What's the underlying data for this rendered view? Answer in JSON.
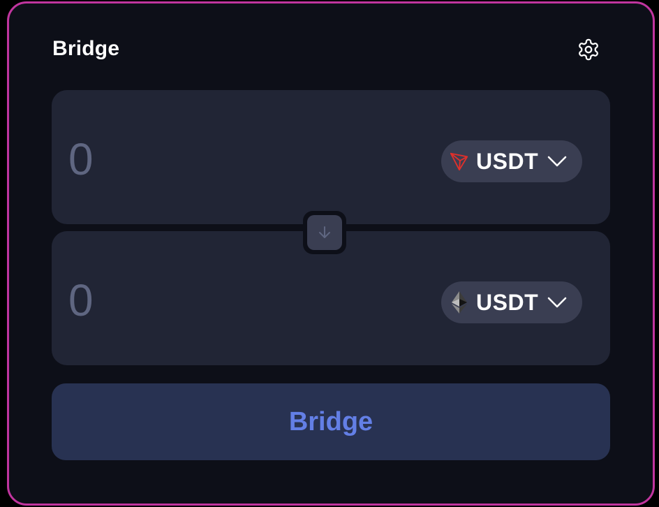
{
  "header": {
    "title": "Bridge",
    "settings_icon": "gear-icon"
  },
  "from": {
    "amount_placeholder": "0",
    "token_symbol": "USDT",
    "chain_icon": "tron-icon"
  },
  "to": {
    "amount_placeholder": "0",
    "token_symbol": "USDT",
    "chain_icon": "ethereum-icon"
  },
  "swap": {
    "icon": "arrow-down-icon"
  },
  "action": {
    "bridge_label": "Bridge"
  },
  "colors": {
    "card_border": "#c1359f",
    "card_background": "#0d0f18",
    "panel_background": "#212535",
    "token_pill": "#3a3e52",
    "button_background": "#283252",
    "button_text": "#637fe6",
    "tron_red": "#e0302b"
  }
}
